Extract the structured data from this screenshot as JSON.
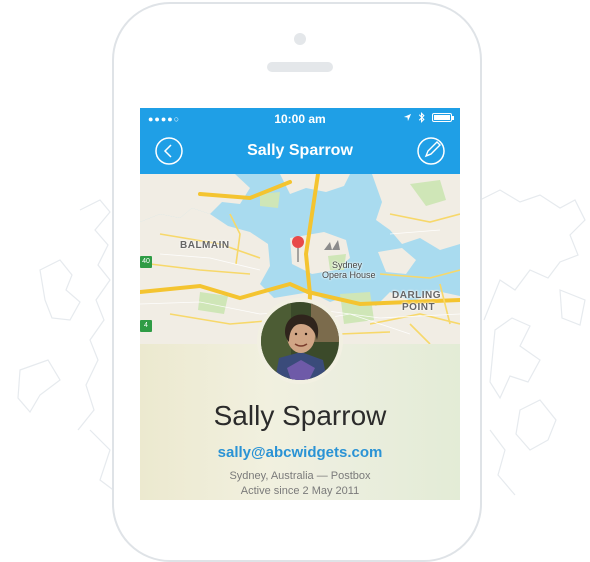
{
  "status_bar": {
    "signal": "●●●●○",
    "time": "10:00 am"
  },
  "nav": {
    "title": "Sally Sparrow",
    "back_icon": "chevron-left-icon",
    "edit_icon": "compose-icon"
  },
  "map": {
    "labels": {
      "balmain": "BALMAIN",
      "sydney": "Sydney",
      "opera_house": "Opera House",
      "darling": "DARLING",
      "point": "POINT"
    },
    "signs": [
      "40",
      "4"
    ]
  },
  "profile": {
    "name": "Sally Sparrow",
    "email": "sally@abcwidgets.com",
    "location": "Sydney, Australia — Postbox",
    "active_since": "Active since 2 May 2011"
  },
  "colors": {
    "accent": "#1f9fe6",
    "link": "#2a93d5",
    "pin": "#e84a4a"
  }
}
